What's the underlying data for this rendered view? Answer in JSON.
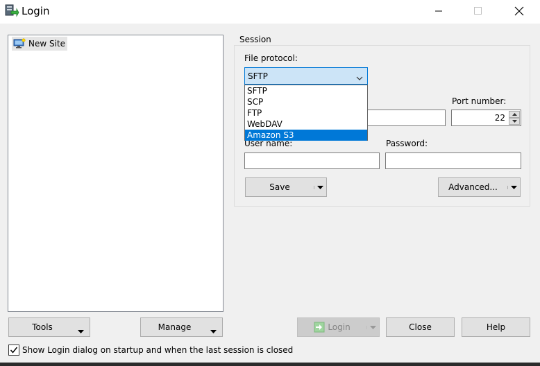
{
  "window": {
    "title": "Login"
  },
  "site_tree": {
    "items": [
      {
        "label": "New Site",
        "icon": "monitor-new-site-icon"
      }
    ]
  },
  "session": {
    "legend": "Session",
    "file_protocol_label": "File protocol:",
    "file_protocol_value": "SFTP",
    "protocol_options": [
      "SFTP",
      "SCP",
      "FTP",
      "WebDAV",
      "Amazon S3"
    ],
    "highlighted_option": "Amazon S3",
    "host_value": "",
    "port_label": "Port number:",
    "port_value": "22",
    "username_label": "User name:",
    "username_value": "",
    "password_label": "Password:",
    "password_value": "",
    "save_label": "Save",
    "advanced_label": "Advanced..."
  },
  "footer": {
    "tools_label": "Tools",
    "manage_label": "Manage",
    "login_label": "Login",
    "close_label": "Close",
    "help_label": "Help",
    "show_login_label": "Show Login dialog on startup and when the last session is closed",
    "show_login_checked": true
  },
  "colors": {
    "selection": "#0078d7",
    "select_bg": "#cce4f7",
    "button_face": "#e1e1e1",
    "window_bg": "#f0f0f0"
  }
}
